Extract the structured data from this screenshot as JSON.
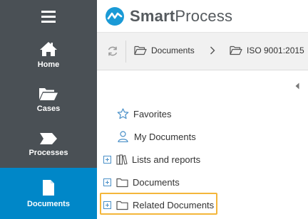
{
  "app": {
    "brand_bold": "Smart",
    "brand_light": "Process"
  },
  "sidebar": {
    "items": [
      {
        "label": "Home",
        "icon": "home-icon"
      },
      {
        "label": "Cases",
        "icon": "folder-open-icon"
      },
      {
        "label": "Processes",
        "icon": "process-arrow-icon"
      },
      {
        "label": "Documents",
        "icon": "document-icon",
        "active": true
      }
    ]
  },
  "breadcrumb": {
    "items": [
      "Documents",
      "ISO 9001:2015"
    ]
  },
  "tree": {
    "items": [
      {
        "label": "Favorites",
        "icon": "star-icon"
      },
      {
        "label": "My Documents",
        "icon": "user-icon"
      },
      {
        "label": "Lists and reports",
        "icon": "books-icon"
      },
      {
        "label": "Documents",
        "icon": "folder-icon"
      },
      {
        "label": "Related Documents",
        "icon": "folder-icon"
      }
    ]
  },
  "colors": {
    "sidebar_bg": "#4a5055",
    "active_bg": "#0087c8",
    "highlight": "#f4b63a",
    "brand_blue": "#1a9ad6"
  }
}
